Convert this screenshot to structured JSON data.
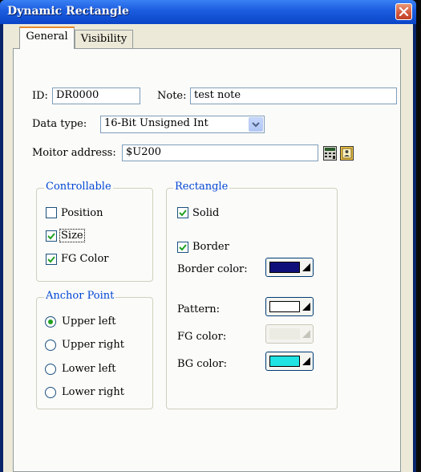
{
  "window": {
    "title": "Dynamic Rectangle"
  },
  "tabs": [
    {
      "label": "General",
      "active": true
    },
    {
      "label": "Visibility",
      "active": false
    }
  ],
  "id": {
    "label": "ID:",
    "value": "DR0000"
  },
  "note": {
    "label": "Note:",
    "value": "test note"
  },
  "data_type": {
    "label": "Data type:",
    "selected": "16-Bit Unsigned Int"
  },
  "monitor_address": {
    "label": "Moitor address:",
    "value": "$U200"
  },
  "controllable": {
    "title": "Controllable",
    "items": [
      {
        "label": "Position",
        "checked": false
      },
      {
        "label": "Size",
        "checked": true
      },
      {
        "label": "FG Color",
        "checked": true
      }
    ]
  },
  "anchor_point": {
    "title": "Anchor Point",
    "options": [
      {
        "label": "Upper left",
        "selected": true
      },
      {
        "label": "Upper right",
        "selected": false
      },
      {
        "label": "Lower left",
        "selected": false
      },
      {
        "label": "Lower right",
        "selected": false
      }
    ]
  },
  "rectangle": {
    "title": "Rectangle",
    "solid": {
      "label": "Solid",
      "checked": true
    },
    "border": {
      "label": "Border",
      "checked": true
    },
    "border_color": {
      "label": "Border color:",
      "color": "#10107a"
    },
    "pattern": {
      "label": "Pattern:",
      "color": "#ffffff"
    },
    "fg_color": {
      "label": "FG color:",
      "color": "#ecebe3",
      "disabled": true
    },
    "bg_color": {
      "label": "BG color:",
      "color": "#22e3e3"
    }
  },
  "colors": {
    "title_bar": "#0b45c8",
    "close_button": "#d2563a",
    "group_title": "#0046d5",
    "active_tab_accent": "#e68b2c",
    "check": "#21a121"
  },
  "icons": {
    "close": "close-icon",
    "calculator": "calculator-icon",
    "address_book": "address-book-icon",
    "chevron": "chevron-down-icon",
    "color_dropdown": "color-dropdown-arrow-icon"
  }
}
